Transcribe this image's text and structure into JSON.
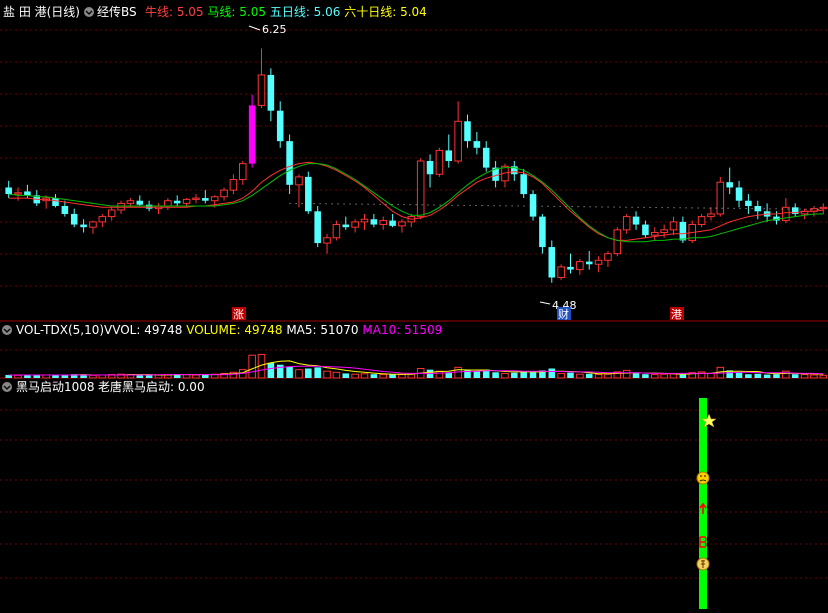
{
  "colors": {
    "up": "#ff3232",
    "down": "#54ffff",
    "ma5": "#ffffff",
    "ma10": "#ffff00",
    "ma20": "#ff3030",
    "ma60": "#00c000",
    "grid": "#8b0000",
    "highlight": "#ff00ff",
    "signal": "#00ff00"
  },
  "header": {
    "stock_name": "盐 田 港(日线)",
    "indicator_name": "经传BS",
    "ma_items": [
      {
        "label": "牛线: ",
        "value": "5.05",
        "color": "#ff4040"
      },
      {
        "label": "马线: ",
        "value": "5.05",
        "color": "#00ff00"
      },
      {
        "label": "五日线: ",
        "value": "5.06",
        "color": "#54ffff"
      },
      {
        "label": "六十日线: ",
        "value": "5.04",
        "color": "#ffff00"
      }
    ]
  },
  "vol_header": {
    "title": "VOL-TDX(5,10)",
    "items": [
      {
        "label": "VVOL: ",
        "value": "49748",
        "color": "#ffffff"
      },
      {
        "label": "VOLUME: ",
        "value": "49748",
        "color": "#ffff00"
      },
      {
        "label": "MA5: ",
        "value": "51070",
        "color": "#ffffff"
      },
      {
        "label": "MA10: ",
        "value": "51509",
        "color": "#ff00ff"
      }
    ]
  },
  "signal_header": {
    "title": "黑马启动1008",
    "items": [
      {
        "label": "老唐黑马启动: ",
        "value": "0.00",
        "color": "#ffffff"
      }
    ]
  },
  "annotations": {
    "high_label": "6.25",
    "low_label": "4.48",
    "markers": [
      "涨",
      "财",
      "港"
    ]
  },
  "chart_data": [
    {
      "type": "candlestick",
      "title": "盐 田 港(日线)",
      "ylim": [
        4.35,
        6.45
      ],
      "price_high": 6.25,
      "price_low": 4.48,
      "candles_ohlc": [
        [
          5.2,
          5.25,
          5.12,
          5.15
        ],
        [
          5.15,
          5.2,
          5.1,
          5.16
        ],
        [
          5.17,
          5.22,
          5.12,
          5.14
        ],
        [
          5.14,
          5.18,
          5.06,
          5.08
        ],
        [
          5.1,
          5.14,
          5.04,
          5.12
        ],
        [
          5.12,
          5.15,
          5.05,
          5.06
        ],
        [
          5.06,
          5.1,
          4.98,
          5.0
        ],
        [
          5.0,
          5.04,
          4.9,
          4.92
        ],
        [
          4.92,
          4.96,
          4.86,
          4.9
        ],
        [
          4.9,
          4.95,
          4.85,
          4.94
        ],
        [
          4.94,
          5.0,
          4.9,
          4.98
        ],
        [
          4.98,
          5.05,
          4.95,
          5.03
        ],
        [
          5.03,
          5.1,
          5.0,
          5.08
        ],
        [
          5.08,
          5.12,
          5.05,
          5.1
        ],
        [
          5.1,
          5.14,
          5.06,
          5.07
        ],
        [
          5.07,
          5.1,
          5.02,
          5.04
        ],
        [
          5.04,
          5.08,
          5.0,
          5.06
        ],
        [
          5.06,
          5.12,
          5.03,
          5.1
        ],
        [
          5.1,
          5.14,
          5.06,
          5.08
        ],
        [
          5.08,
          5.12,
          5.05,
          5.11
        ],
        [
          5.11,
          5.15,
          5.08,
          5.12
        ],
        [
          5.12,
          5.18,
          5.08,
          5.1
        ],
        [
          5.1,
          5.14,
          5.05,
          5.13
        ],
        [
          5.13,
          5.2,
          5.1,
          5.18
        ],
        [
          5.18,
          5.3,
          5.15,
          5.26
        ],
        [
          5.26,
          5.4,
          5.22,
          5.38
        ],
        [
          5.38,
          5.9,
          5.35,
          5.82
        ],
        [
          5.82,
          6.25,
          5.8,
          6.05
        ],
        [
          6.05,
          6.1,
          5.7,
          5.78
        ],
        [
          5.78,
          5.85,
          5.5,
          5.55
        ],
        [
          5.55,
          5.6,
          5.15,
          5.22
        ],
        [
          5.22,
          5.3,
          5.05,
          5.28
        ],
        [
          5.28,
          5.32,
          5.0,
          5.02
        ],
        [
          5.02,
          5.06,
          4.75,
          4.78
        ],
        [
          4.78,
          4.85,
          4.7,
          4.82
        ],
        [
          4.82,
          4.95,
          4.8,
          4.92
        ],
        [
          4.92,
          4.98,
          4.88,
          4.9
        ],
        [
          4.9,
          4.96,
          4.86,
          4.94
        ],
        [
          4.94,
          5.0,
          4.88,
          4.96
        ],
        [
          4.96,
          5.0,
          4.9,
          4.92
        ],
        [
          4.92,
          4.98,
          4.88,
          4.95
        ],
        [
          4.95,
          5.0,
          4.9,
          4.91
        ],
        [
          4.91,
          4.96,
          4.86,
          4.94
        ],
        [
          4.94,
          5.0,
          4.9,
          4.98
        ],
        [
          4.98,
          5.42,
          4.96,
          5.4
        ],
        [
          5.4,
          5.45,
          5.2,
          5.3
        ],
        [
          5.3,
          5.5,
          5.28,
          5.48
        ],
        [
          5.48,
          5.6,
          5.35,
          5.4
        ],
        [
          5.4,
          5.85,
          5.38,
          5.7
        ],
        [
          5.7,
          5.75,
          5.5,
          5.55
        ],
        [
          5.55,
          5.62,
          5.45,
          5.5
        ],
        [
          5.5,
          5.55,
          5.32,
          5.35
        ],
        [
          5.35,
          5.4,
          5.2,
          5.25
        ],
        [
          5.25,
          5.38,
          5.2,
          5.36
        ],
        [
          5.36,
          5.4,
          5.25,
          5.3
        ],
        [
          5.3,
          5.34,
          5.12,
          5.15
        ],
        [
          5.15,
          5.18,
          4.95,
          4.98
        ],
        [
          4.98,
          5.0,
          4.7,
          4.75
        ],
        [
          4.75,
          4.8,
          4.48,
          4.52
        ],
        [
          4.52,
          4.62,
          4.5,
          4.6
        ],
        [
          4.6,
          4.7,
          4.55,
          4.58
        ],
        [
          4.58,
          4.66,
          4.54,
          4.64
        ],
        [
          4.64,
          4.72,
          4.58,
          4.62
        ],
        [
          4.62,
          4.68,
          4.56,
          4.65
        ],
        [
          4.65,
          4.72,
          4.6,
          4.7
        ],
        [
          4.7,
          4.9,
          4.68,
          4.88
        ],
        [
          4.88,
          5.0,
          4.85,
          4.98
        ],
        [
          4.98,
          5.02,
          4.88,
          4.92
        ],
        [
          4.92,
          4.95,
          4.82,
          4.84
        ],
        [
          4.84,
          4.9,
          4.8,
          4.86
        ],
        [
          4.86,
          4.92,
          4.82,
          4.88
        ],
        [
          4.88,
          4.98,
          4.84,
          4.94
        ],
        [
          4.94,
          4.98,
          4.78,
          4.8
        ],
        [
          4.8,
          4.95,
          4.78,
          4.92
        ],
        [
          4.92,
          5.0,
          4.9,
          4.98
        ],
        [
          4.98,
          5.05,
          4.95,
          5.0
        ],
        [
          5.0,
          5.28,
          4.98,
          5.24
        ],
        [
          5.24,
          5.35,
          5.15,
          5.2
        ],
        [
          5.2,
          5.25,
          5.05,
          5.1
        ],
        [
          5.1,
          5.15,
          5.0,
          5.06
        ],
        [
          5.06,
          5.1,
          4.96,
          5.02
        ],
        [
          5.02,
          5.08,
          4.94,
          4.98
        ],
        [
          4.98,
          5.02,
          4.92,
          4.95
        ],
        [
          4.95,
          5.12,
          4.93,
          5.05
        ],
        [
          5.05,
          5.08,
          4.98,
          5.0
        ],
        [
          5.0,
          5.04,
          4.96,
          5.02
        ],
        [
          5.02,
          5.06,
          4.98,
          5.04
        ],
        [
          5.04,
          5.08,
          5.0,
          5.05
        ]
      ],
      "ma_series": [
        {
          "name": "MA20",
          "values": [
            5.12,
            5.12,
            5.12,
            5.11,
            5.11,
            5.1,
            5.09,
            5.08,
            5.07,
            5.06,
            5.05,
            5.05,
            5.05,
            5.05,
            5.05,
            5.05,
            5.05,
            5.05,
            5.05,
            5.05,
            5.06,
            5.06,
            5.07,
            5.08,
            5.09,
            5.12,
            5.17,
            5.24,
            5.29,
            5.33,
            5.36,
            5.38,
            5.39,
            5.38,
            5.36,
            5.33,
            5.29,
            5.25,
            5.2,
            5.14,
            5.08,
            5.02,
            4.98,
            4.96,
            4.97,
            4.99,
            5.03,
            5.08,
            5.14,
            5.19,
            5.24,
            5.27,
            5.29,
            5.31,
            5.32,
            5.31,
            5.28,
            5.23,
            5.16,
            5.09,
            5.02,
            4.96,
            4.9,
            4.85,
            4.82,
            4.8,
            4.8,
            4.81,
            4.82,
            4.83,
            4.84,
            4.85,
            4.85,
            4.86,
            4.87,
            4.88,
            4.91,
            4.94,
            4.96,
            4.98,
            4.99,
            5.0,
            5.0,
            5.01,
            5.01,
            5.02,
            5.02,
            5.03
          ]
        },
        {
          "name": "MA60",
          "values": [
            5.15,
            5.14,
            5.14,
            5.13,
            5.13,
            5.12,
            5.11,
            5.1,
            5.09,
            5.08,
            5.07,
            5.06,
            5.06,
            5.06,
            5.06,
            5.06,
            5.06,
            5.06,
            5.06,
            5.06,
            5.06,
            5.06,
            5.06,
            5.07,
            5.08,
            5.1,
            5.14,
            5.19,
            5.24,
            5.29,
            5.33,
            5.36,
            5.38,
            5.38,
            5.37,
            5.34,
            5.3,
            5.26,
            5.21,
            5.16,
            5.11,
            5.06,
            5.02,
            4.99,
            4.99,
            5.01,
            5.05,
            5.1,
            5.16,
            5.22,
            5.27,
            5.31,
            5.34,
            5.35,
            5.35,
            5.33,
            5.29,
            5.24,
            5.18,
            5.11,
            5.04,
            4.97,
            4.91,
            4.86,
            4.82,
            4.8,
            4.79,
            4.79,
            4.79,
            4.8,
            4.8,
            4.81,
            4.81,
            4.82,
            4.82,
            4.83,
            4.85,
            4.87,
            4.89,
            4.91,
            4.93,
            4.95,
            4.96,
            4.97,
            4.98,
            4.99,
            5.0,
            5.0
          ]
        }
      ]
    },
    {
      "type": "bar",
      "title": "VOL-TDX(5,10)",
      "ylim": [
        0,
        100
      ],
      "values": [
        8,
        7,
        8,
        9,
        8,
        7,
        9,
        10,
        8,
        7,
        8,
        9,
        10,
        9,
        8,
        7,
        8,
        9,
        10,
        9,
        8,
        9,
        10,
        12,
        15,
        22,
        60,
        62,
        40,
        35,
        30,
        22,
        25,
        28,
        18,
        15,
        12,
        10,
        11,
        10,
        9,
        10,
        9,
        11,
        25,
        22,
        18,
        15,
        28,
        20,
        18,
        22,
        15,
        12,
        14,
        18,
        15,
        20,
        25,
        12,
        14,
        10,
        11,
        9,
        10,
        16,
        20,
        12,
        10,
        9,
        10,
        11,
        9,
        14,
        16,
        12,
        28,
        20,
        14,
        10,
        11,
        9,
        10,
        18,
        10,
        9,
        8,
        7
      ],
      "series": [
        {
          "name": "MA5",
          "values": [
            8,
            8,
            8,
            8,
            8,
            8,
            8,
            8,
            9,
            8,
            8,
            8,
            8,
            9,
            9,
            9,
            8,
            8,
            9,
            9,
            9,
            9,
            9,
            10,
            11,
            14,
            24,
            34,
            40,
            44,
            45,
            38,
            34,
            32,
            27,
            24,
            20,
            17,
            15,
            13,
            11,
            10,
            10,
            10,
            13,
            15,
            17,
            18,
            22,
            21,
            21,
            21,
            19,
            17,
            16,
            16,
            16,
            16,
            18,
            18,
            17,
            16,
            14,
            11,
            11,
            12,
            13,
            14,
            13,
            13,
            12,
            11,
            10,
            11,
            12,
            12,
            16,
            18,
            18,
            17,
            17,
            13,
            11,
            12,
            12,
            11,
            11,
            10
          ]
        },
        {
          "name": "MA10",
          "values": [
            8,
            8,
            8,
            8,
            8,
            8,
            8,
            8,
            8,
            8,
            8,
            8,
            8,
            8,
            8,
            8,
            9,
            9,
            9,
            9,
            9,
            9,
            9,
            9,
            10,
            12,
            16,
            21,
            25,
            28,
            30,
            31,
            31,
            31,
            30,
            29,
            28,
            26,
            23,
            20,
            17,
            15,
            13,
            12,
            12,
            12,
            13,
            14,
            16,
            17,
            18,
            19,
            19,
            19,
            19,
            18,
            18,
            18,
            17,
            17,
            16,
            16,
            16,
            15,
            14,
            14,
            14,
            14,
            13,
            12,
            12,
            12,
            12,
            12,
            12,
            12,
            13,
            14,
            15,
            15,
            14,
            14,
            14,
            14,
            13,
            12,
            12,
            11
          ]
        }
      ]
    },
    {
      "type": "bar",
      "title": "黑马启动1008",
      "values": [
        0
      ],
      "signal_bars": 1
    }
  ]
}
